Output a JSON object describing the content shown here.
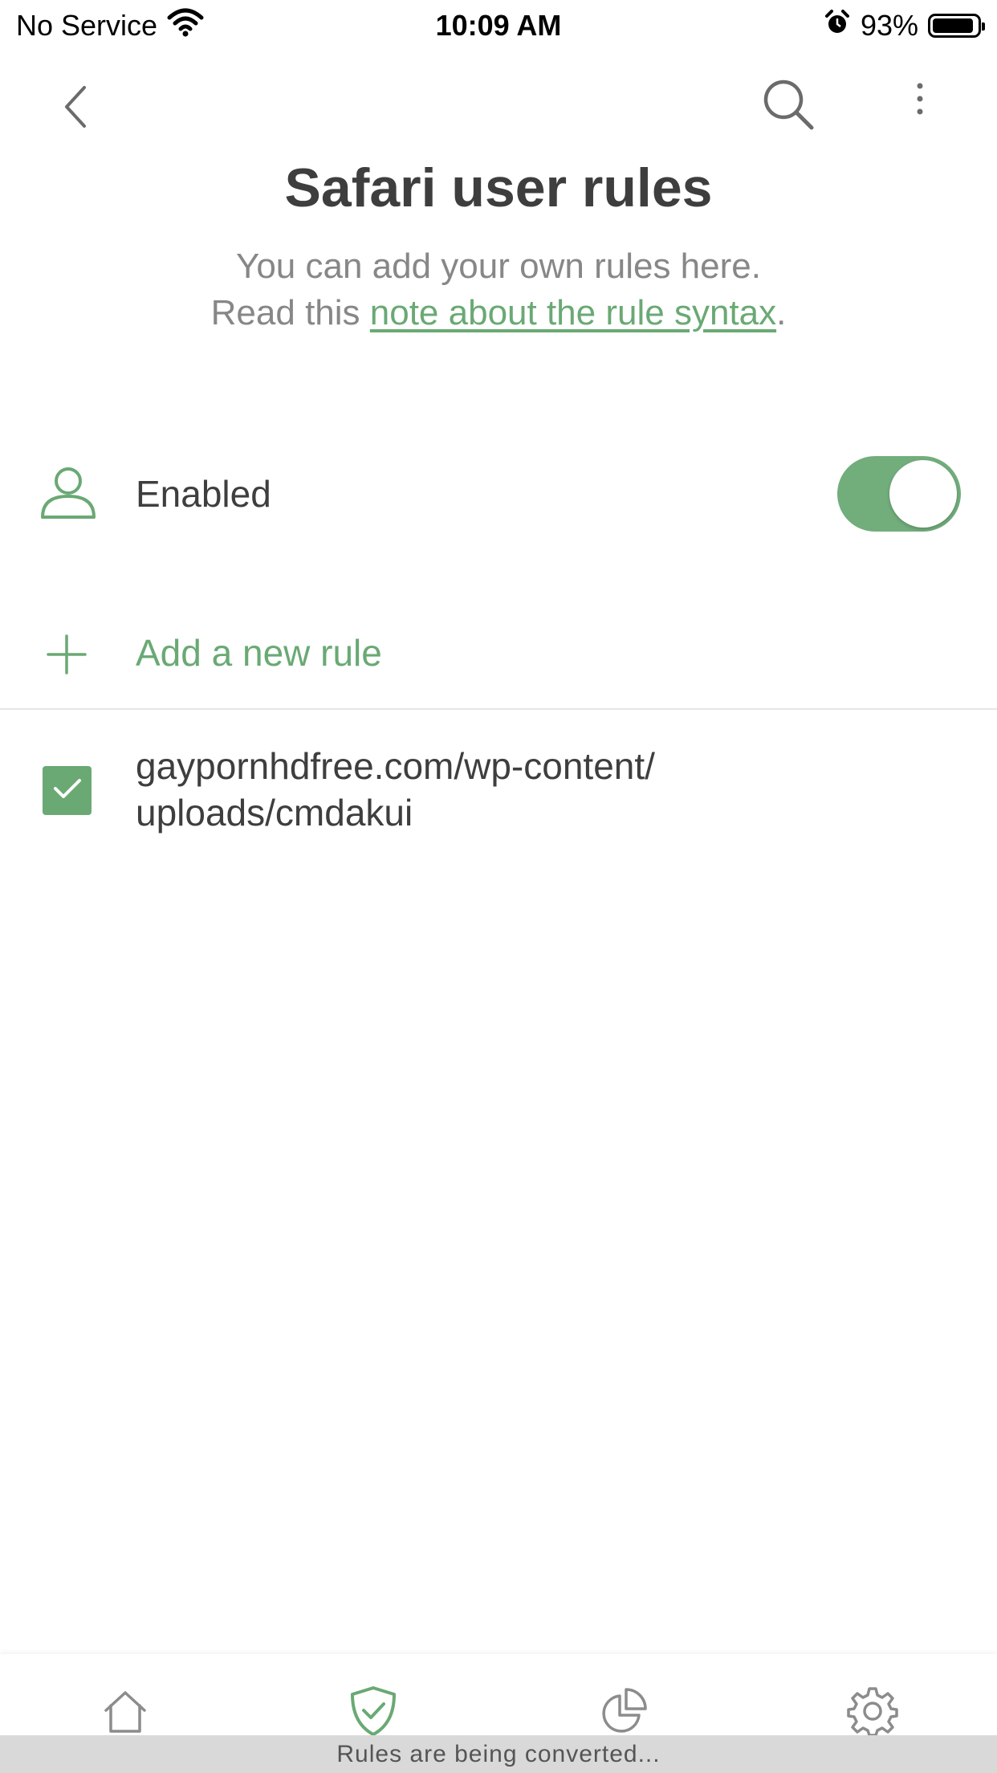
{
  "status_bar": {
    "carrier": "No Service",
    "time": "10:09 AM",
    "battery": "93%",
    "battery_level": 0.93,
    "icons": [
      "wifi-icon",
      "alarm-icon",
      "battery-icon"
    ]
  },
  "nav": {
    "icons": [
      "back-chevron-icon",
      "search-icon",
      "more-vertical-icon"
    ]
  },
  "header": {
    "title": "Safari user rules",
    "subtitle_line1": "You can add your own rules here.",
    "subtitle_prefix": "Read this ",
    "subtitle_link": "note about the rule syntax",
    "subtitle_suffix": "."
  },
  "enabled_row": {
    "label": "Enabled",
    "icon": "user-icon",
    "toggle_on": true
  },
  "add_rule": {
    "label": "Add a new rule",
    "icon": "plus-icon"
  },
  "rules": [
    {
      "line1": "gaypornhdfree.com/wp-content/",
      "line2": "uploads/cmdakui",
      "checked": true
    }
  ],
  "tabbar": {
    "tabs": [
      {
        "icon": "home-icon",
        "active": false
      },
      {
        "icon": "shield-check-icon",
        "active": true
      },
      {
        "icon": "pie-chart-icon",
        "active": false
      },
      {
        "icon": "gear-icon",
        "active": false
      }
    ],
    "status_message": "Rules are being converted..."
  },
  "colors": {
    "accent": "#6aa974",
    "toggle": "#72ad7c",
    "text": "#3e3e3e",
    "muted": "#878787"
  }
}
